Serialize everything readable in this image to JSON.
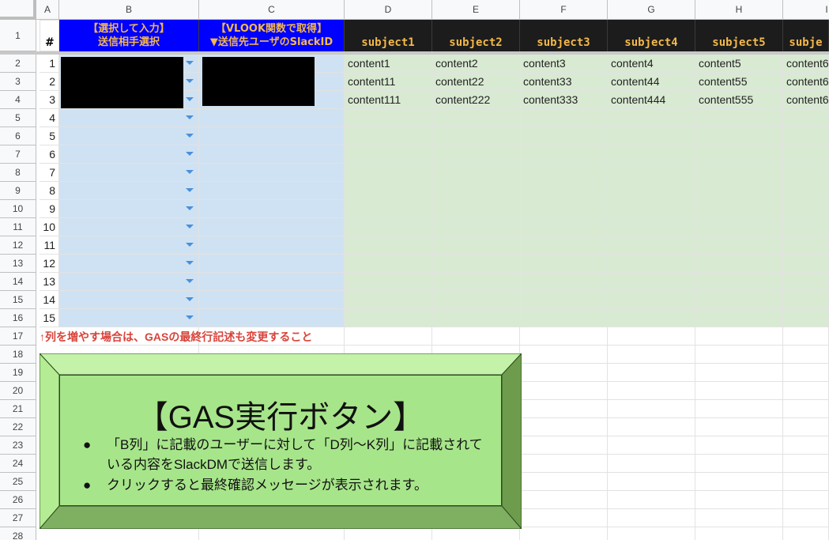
{
  "columns": [
    "A",
    "B",
    "C",
    "D",
    "E",
    "F",
    "G",
    "H",
    "I"
  ],
  "rows": [
    "1",
    "2",
    "3",
    "4",
    "5",
    "6",
    "7",
    "8",
    "9",
    "10",
    "11",
    "12",
    "13",
    "14",
    "15",
    "16",
    "17",
    "18",
    "19",
    "20",
    "21",
    "22",
    "23",
    "24",
    "25",
    "26",
    "27",
    "28"
  ],
  "header": {
    "hash": "#",
    "b_line1": "【選択して入力】",
    "b_line2": "送信相手選択",
    "c_line1": "【VLOOK関数で取得】",
    "c_line2": "▼送信先ユーザのSlackID",
    "subjects": [
      "subject1",
      "subject2",
      "subject3",
      "subject4",
      "subject5",
      "subje"
    ]
  },
  "row_numbers": [
    "1",
    "2",
    "3",
    "4",
    "5",
    "6",
    "7",
    "8",
    "9",
    "10",
    "11",
    "12",
    "13",
    "14",
    "15"
  ],
  "contents": [
    [
      "content1",
      "content2",
      "content3",
      "content4",
      "content5",
      "content6"
    ],
    [
      "content11",
      "content22",
      "content33",
      "content44",
      "content55",
      "content6"
    ],
    [
      "content111",
      "content222",
      "content333",
      "content444",
      "content555",
      "content6"
    ]
  ],
  "note": "↑列を増やす場合は、GASの最終行記述も変更すること",
  "button": {
    "title": "【GAS実行ボタン】",
    "bullet1_line1": "「B列」に記載のユーザーに対して「D列～K列」に記載されて",
    "bullet1_line2": "いる内容をSlackDMで送信します。",
    "bullet2": "クリックすると最終確認メッセージが表示されます。"
  },
  "colors": {
    "header_blue": "#0000ff",
    "header_black": "#1c1c1c",
    "header_text": "#f4b84a",
    "input_blue": "#cfe2f3",
    "content_green": "#d9ead3",
    "button_green": "#a7e58a",
    "note_red": "#d9433a"
  }
}
